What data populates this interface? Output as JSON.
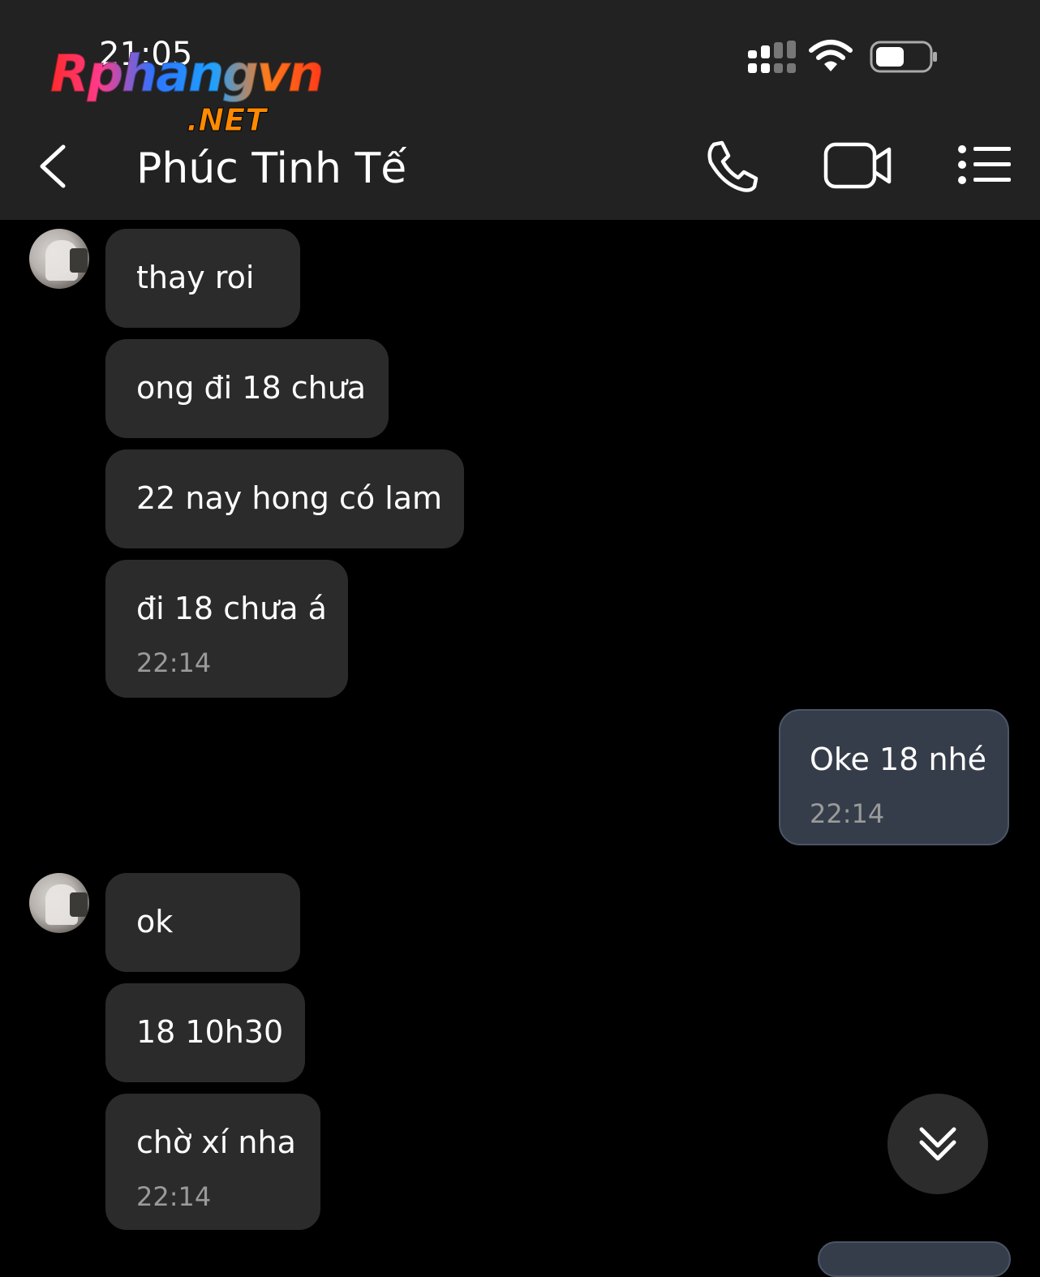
{
  "status_bar": {
    "time": "21:05",
    "icons": [
      "signal-icon",
      "wifi-icon",
      "battery-icon"
    ]
  },
  "watermark": {
    "main": "Rphangvn",
    "sub": ".NET"
  },
  "header": {
    "title": "Phúc Tinh Tế",
    "actions": [
      "back-icon",
      "phone-icon",
      "video-camera-icon",
      "list-menu-icon"
    ]
  },
  "messages": [
    {
      "side": "in",
      "text": "thay roi",
      "time": ""
    },
    {
      "side": "in",
      "text": "ong đi 18 chưa",
      "time": ""
    },
    {
      "side": "in",
      "text": "22 nay hong có lam",
      "time": ""
    },
    {
      "side": "in",
      "text": "đi 18 chưa á",
      "time": "22:14"
    },
    {
      "side": "out",
      "text": "Oke 18 nhé",
      "time": "22:14"
    },
    {
      "side": "in",
      "text": "ok",
      "time": ""
    },
    {
      "side": "in",
      "text": "18 10h30",
      "time": ""
    },
    {
      "side": "in",
      "text": "chờ xí nha",
      "time": "22:14"
    }
  ],
  "colors": {
    "header_bg": "#222222",
    "chat_bg": "#000000",
    "incoming_bubble": "#2b2b2b",
    "outgoing_bubble": "#363d4a",
    "timestamp": "#9a9a9a"
  }
}
